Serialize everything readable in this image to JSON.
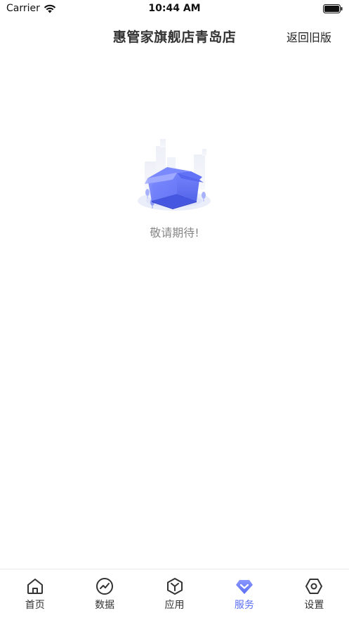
{
  "status_bar": {
    "carrier": "Carrier",
    "time": "10:44 AM"
  },
  "header": {
    "title": "惠管家旗舰店青岛店",
    "back_old_version": "返回旧版"
  },
  "empty_state": {
    "illustration": "open-box",
    "message": "敬请期待!"
  },
  "tab_bar": {
    "active_color": "#5b6ef5",
    "items": [
      {
        "label": "首页",
        "icon": "home-icon"
      },
      {
        "label": "数据",
        "icon": "chart-icon"
      },
      {
        "label": "应用",
        "icon": "apps-icon"
      },
      {
        "label": "服务",
        "icon": "service-icon",
        "active": true
      },
      {
        "label": "设置",
        "icon": "settings-icon"
      }
    ]
  }
}
